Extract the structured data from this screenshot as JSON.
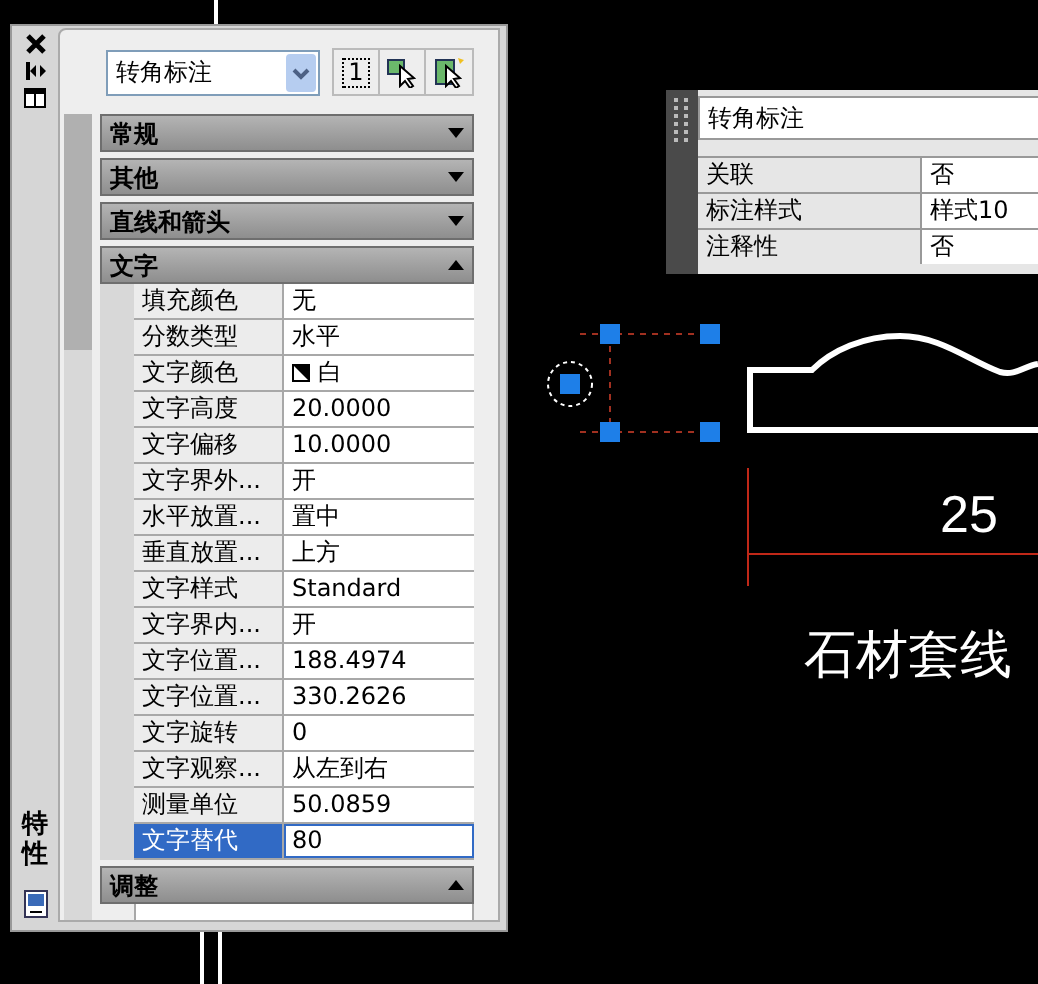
{
  "side_panel": {
    "title": "特性"
  },
  "combo": {
    "value": "转角标注"
  },
  "toolbar": {
    "toggle_label": "1"
  },
  "sections": [
    {
      "title": "常规",
      "expanded": false
    },
    {
      "title": "其他",
      "expanded": false
    },
    {
      "title": "直线和箭头",
      "expanded": false
    },
    {
      "title": "文字",
      "expanded": true,
      "rows": [
        {
          "label": "填充颜色",
          "value": "无",
          "kind": "text",
          "selected": false
        },
        {
          "label": "分数类型",
          "value": "水平",
          "kind": "text",
          "selected": false
        },
        {
          "label": "文字颜色",
          "value": "白",
          "kind": "color",
          "selected": false
        },
        {
          "label": "文字高度",
          "value": "20.0000",
          "kind": "text",
          "selected": false
        },
        {
          "label": "文字偏移",
          "value": "10.0000",
          "kind": "text",
          "selected": false
        },
        {
          "label": "文字界外...",
          "value": "开",
          "kind": "text",
          "selected": false
        },
        {
          "label": "水平放置...",
          "value": "置中",
          "kind": "text",
          "selected": false
        },
        {
          "label": "垂直放置...",
          "value": "上方",
          "kind": "text",
          "selected": false
        },
        {
          "label": "文字样式",
          "value": "Standard",
          "kind": "text",
          "selected": false
        },
        {
          "label": "文字界内...",
          "value": "开",
          "kind": "text",
          "selected": false
        },
        {
          "label": "文字位置...",
          "value": "188.4974",
          "kind": "text",
          "selected": false
        },
        {
          "label": "文字位置...",
          "value": "330.2626",
          "kind": "text",
          "selected": false
        },
        {
          "label": "文字旋转",
          "value": "0",
          "kind": "text",
          "selected": false
        },
        {
          "label": "文字观察...",
          "value": "从左到右",
          "kind": "text",
          "selected": false
        },
        {
          "label": "测量单位",
          "value": "50.0859",
          "kind": "text",
          "selected": false
        },
        {
          "label": "文字替代",
          "value": "80",
          "kind": "text",
          "selected": true
        }
      ]
    },
    {
      "title": "调整",
      "expanded": true
    }
  ],
  "tooltip": {
    "title": "转角标注",
    "rows": [
      {
        "label": "关联",
        "value": "否"
      },
      {
        "label": "标注样式",
        "value": "样式10"
      },
      {
        "label": "注释性",
        "value": "否"
      }
    ]
  },
  "canvas": {
    "dimension_text": "25",
    "label_text": "石材套线"
  }
}
